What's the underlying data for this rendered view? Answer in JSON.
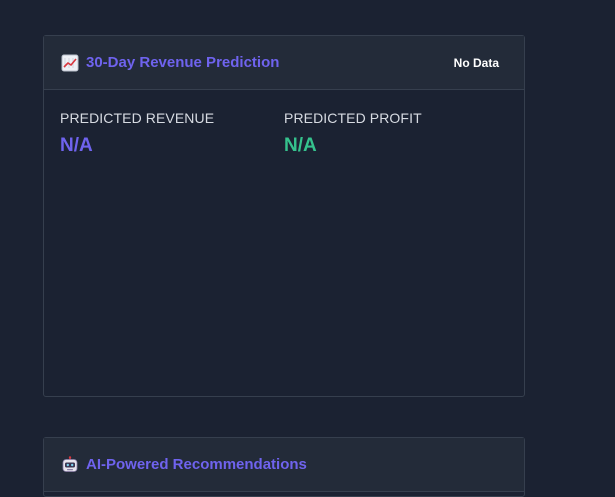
{
  "prediction_card": {
    "title": "30-Day Revenue Prediction",
    "icon": "chart-increasing-icon",
    "badge": "No Data",
    "metrics": [
      {
        "label": "PREDICTED REVENUE",
        "value": "N/A"
      },
      {
        "label": "PREDICTED PROFIT",
        "value": "N/A"
      }
    ]
  },
  "recommendations_card": {
    "title": "AI-Powered Recommendations",
    "icon": "robot-icon"
  },
  "colors": {
    "background": "#1b2232",
    "header_background": "#232b39",
    "accent_purple": "#6f63ee",
    "accent_green": "#35c28d",
    "border": "#363f4e"
  }
}
